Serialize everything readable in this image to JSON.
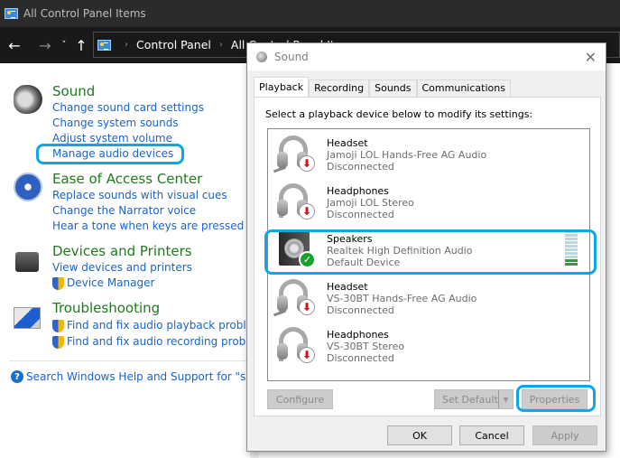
{
  "window": {
    "title": "All Control Panel Items"
  },
  "nav": {
    "back_icon": "←",
    "forward_icon": "→",
    "recent_icon": "˅",
    "up_icon": "↑",
    "breadcrumb": [
      "Control Panel",
      "All Control Panel Items"
    ],
    "separator": "›"
  },
  "groups": [
    {
      "title": "Sound",
      "links": [
        "Change sound card settings",
        "Change system sounds",
        "Adjust system volume",
        "Manage audio devices"
      ]
    },
    {
      "title": "Ease of Access Center",
      "links": [
        "Replace sounds with visual cues",
        "Change the Narrator voice",
        "Hear a tone when keys are pressed"
      ]
    },
    {
      "title": "Devices and Printers",
      "links": [
        "View devices and printers",
        "Device Manager"
      ]
    },
    {
      "title": "Troubleshooting",
      "links": [
        "Find and fix audio playback problems",
        "Find and fix audio recording problems"
      ]
    }
  ],
  "help_link": "Search Windows Help and Support for \"sound\"",
  "help_icon": "?",
  "dialog": {
    "title": "Sound",
    "close_icon": "✕",
    "tabs": [
      "Playback",
      "Recording",
      "Sounds",
      "Communications"
    ],
    "active_tab": "Playback",
    "instruction": "Select a playback device below to modify its settings:",
    "devices": [
      {
        "name": "Headset",
        "description": "Jamoji LOL Hands-Free AG Audio",
        "status": "Disconnected",
        "type": "headset"
      },
      {
        "name": "Headphones",
        "description": "Jamoji LOL Stereo",
        "status": "Disconnected",
        "type": "headphones"
      },
      {
        "name": "Speakers",
        "description": "Realtek High Definition Audio",
        "status": "Default Device",
        "type": "speakers",
        "meter_level_fraction": 0.2
      },
      {
        "name": "Headset",
        "description": "VS-30BT Hands-Free AG Audio",
        "status": "Disconnected",
        "type": "headset"
      },
      {
        "name": "Headphones",
        "description": "VS-30BT Stereo",
        "status": "Disconnected",
        "type": "headphones"
      }
    ],
    "badge_disconnected": "⬇",
    "badge_default": "✓",
    "buttons": {
      "configure": "Configure",
      "set_default": "Set Default",
      "set_default_arrow": "▼",
      "properties": "Properties",
      "ok": "OK",
      "cancel": "Cancel",
      "apply": "Apply"
    }
  },
  "highlight_color": "#0ea5e9"
}
